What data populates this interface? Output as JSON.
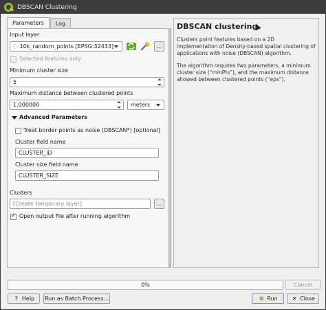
{
  "window": {
    "title": "DBSCAN Clustering"
  },
  "tabs": [
    {
      "label": "Parameters",
      "active": true
    },
    {
      "label": "Log",
      "active": false
    }
  ],
  "params": {
    "input_layer_label": "Input layer",
    "input_layer_value": "10k_random_points [EPSG:32433]",
    "selected_only_label": "Selected features only",
    "min_cluster_label": "Minimum cluster size",
    "min_cluster_value": "5",
    "max_dist_label": "Maximum distance between clustered points",
    "max_dist_value": "1.000000",
    "unit_value": "meters",
    "advanced_label": "Advanced Parameters",
    "border_noise_label": "Treat border points as noise (DBSCAN*) [optional]",
    "cluster_field_label": "Cluster field name",
    "cluster_field_value": "CLUSTER_ID",
    "cluster_size_label": "Cluster size field name",
    "cluster_size_value": "CLUSTER_SIZE",
    "clusters_label": "Clusters",
    "clusters_placeholder": "[Create temporary layer]",
    "open_output_label": "Open output file after running algorithm",
    "ellipsis": "..."
  },
  "help": {
    "title": "DBSCAN clustering",
    "p1": "Clusters point features based on a 2D implementation of Density-based spatial clustering of applications with noise (DBSCAN) algorithm.",
    "p2": "The algorithm requires two parameters, a minimum cluster size (“minPts”), and the maximum distance allowed between clustered points (“eps”)."
  },
  "progress": {
    "text": "0%",
    "value": 0
  },
  "buttons": {
    "cancel": "Cancel",
    "help": "Help",
    "batch": "Run as Batch Process...",
    "run": "Run",
    "close": "Close"
  },
  "colors": {
    "qgis_green": "#8fbf3a",
    "progress_fill": "#6c9bd2"
  },
  "icons": {
    "iterate": "iterate-icon",
    "settings": "wrench-icon",
    "help": "help-icon",
    "run": "run-icon",
    "close": "close-icon"
  }
}
